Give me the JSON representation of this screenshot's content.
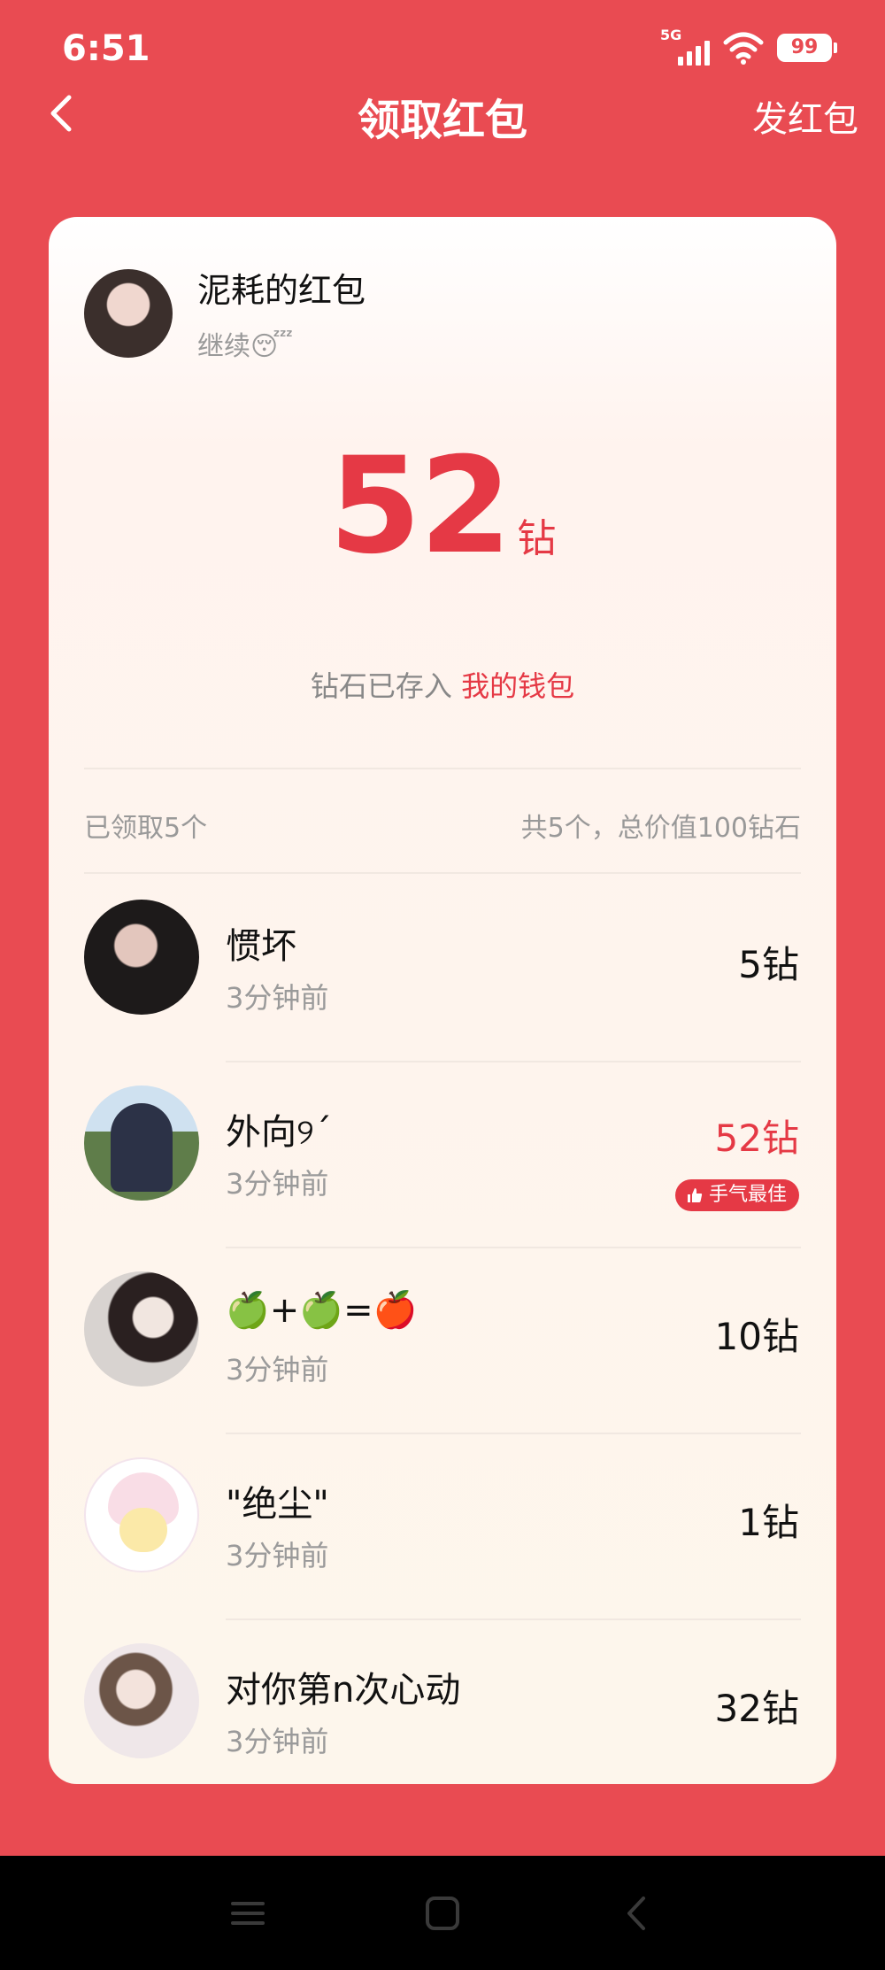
{
  "status_bar": {
    "time": "6:51",
    "network": "5G",
    "battery": "99"
  },
  "header": {
    "title": "领取红包",
    "send_label": "发红包"
  },
  "packet": {
    "sender_name": "泥耗的红包",
    "message": "继续😴",
    "amount": "52",
    "unit": "钻",
    "wallet_prefix": "钻石已存入",
    "wallet_link": "我的钱包"
  },
  "summary": {
    "claimed": "已领取5个",
    "total": "共5个，总价值100钻石"
  },
  "claims": [
    {
      "name": "惯坏",
      "time": "3分钟前",
      "amount": "5钻",
      "best": false
    },
    {
      "name": "外向୨ˊ",
      "time": "3分钟前",
      "amount": "52钻",
      "best": true,
      "badge": "手气最佳"
    },
    {
      "name": "🍏+🍏=🍎",
      "time": "3分钟前",
      "amount": "10钻",
      "best": false
    },
    {
      "name": "\"绝尘\"",
      "time": "3分钟前",
      "amount": "1钻",
      "best": false
    },
    {
      "name": "对你第n次心动",
      "time": "3分钟前",
      "amount": "32钻",
      "best": false
    }
  ],
  "colors": {
    "background": "#E94B52",
    "accent": "#E53945",
    "card": "#FDF6EC"
  },
  "icons": [
    "back-icon",
    "cellular-signal-icon",
    "wifi-icon",
    "battery-icon",
    "thumbs-up-icon",
    "menu-icon",
    "home-icon",
    "nav-back-icon"
  ]
}
